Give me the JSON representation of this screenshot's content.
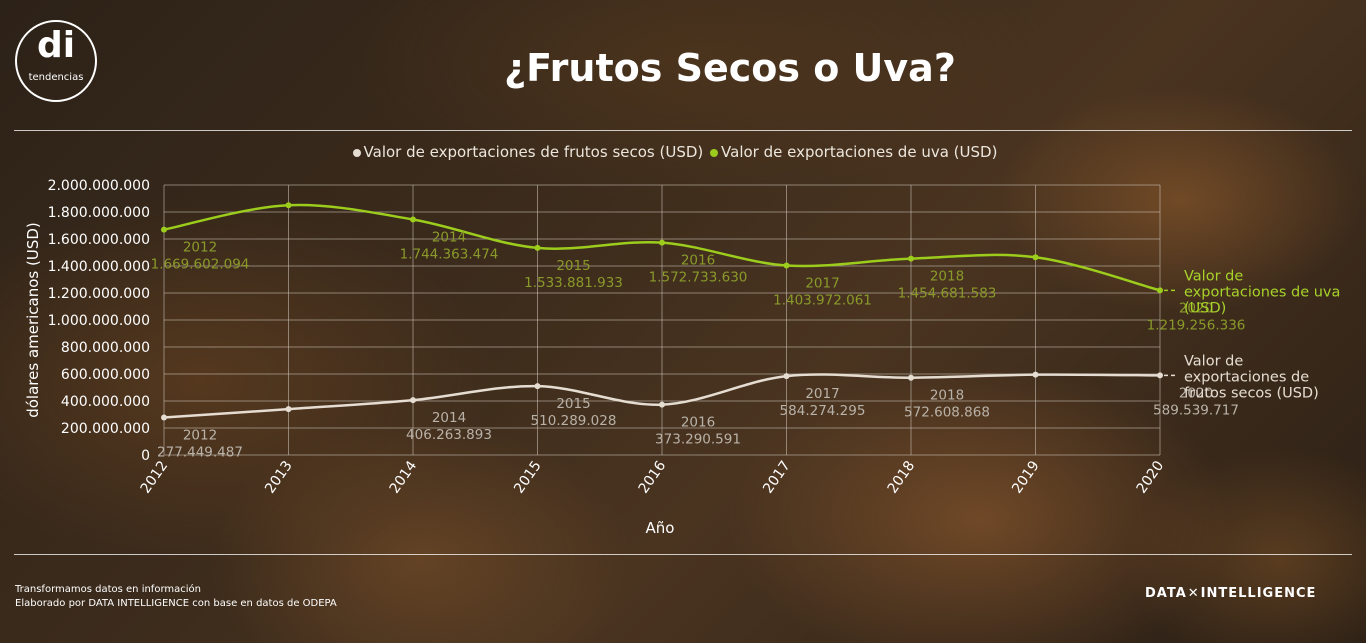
{
  "logo": {
    "mark": "di",
    "text": "tendencias"
  },
  "title": "¿Frutos Secos o Uva?",
  "colors": {
    "uva": "#9ccc1c",
    "frutos": "#e6ddd2",
    "uva_label": "#8a9a2a",
    "frutos_label": "#b9b2a8",
    "grid": "#cfc7bb"
  },
  "legend": {
    "frutos": "Valor de exportaciones de frutos secos (USD)",
    "uva": "Valor de exportaciones de uva (USD)"
  },
  "end_labels": {
    "uva": [
      "Valor de",
      "exportaciones de uva",
      "(USD)"
    ],
    "frutos": [
      "Valor de",
      "exportaciones de",
      "frutos secos (USD)"
    ]
  },
  "chart_data": {
    "type": "line",
    "title": "¿Frutos Secos o Uva?",
    "xlabel": "Año",
    "ylabel": "dólares americanos (USD)",
    "x": [
      "2012",
      "2013",
      "2014",
      "2015",
      "2016",
      "2017",
      "2018",
      "2019",
      "2020"
    ],
    "ylim": [
      0,
      2000000000
    ],
    "yticks": [
      "0",
      "200.000.000",
      "400.000.000",
      "600.000.000",
      "800.000.000",
      "1.000.000.000",
      "1.200.000.000",
      "1.400.000.000",
      "1.600.000.000",
      "1.800.000.000",
      "2.000.000.000"
    ],
    "grid": true,
    "legend_position": "top",
    "series": [
      {
        "name": "Valor de exportaciones de frutos secos (USD)",
        "key": "frutos",
        "values": [
          277449487,
          340000000,
          406263893,
          510289028,
          373290591,
          584274295,
          572608868,
          595000000,
          589539717
        ],
        "labels": [
          "277.449.487",
          null,
          "406.263.893",
          "510.289.028",
          "373.290.591",
          "584.274.295",
          "572.608.868",
          null,
          "589.539.717"
        ]
      },
      {
        "name": "Valor de exportaciones de uva (USD)",
        "key": "uva",
        "values": [
          1669602094,
          1850000000,
          1744363474,
          1533881933,
          1572733630,
          1403972061,
          1454681583,
          1465000000,
          1219256336
        ],
        "labels": [
          "1.669.602.094",
          null,
          "1.744.363.474",
          "1.533.881.933",
          "1.572.733.630",
          "1.403.972.061",
          "1.454.681.583",
          null,
          "1.219.256.336"
        ]
      }
    ]
  },
  "footer": {
    "line1": "Transformamos datos en información",
    "line2": "Elaborado por DATA INTELLIGENCE con base en datos de ODEPA"
  },
  "brand": {
    "left": "DATA",
    "mark": "✕",
    "right": "INTELLIGENCE"
  }
}
